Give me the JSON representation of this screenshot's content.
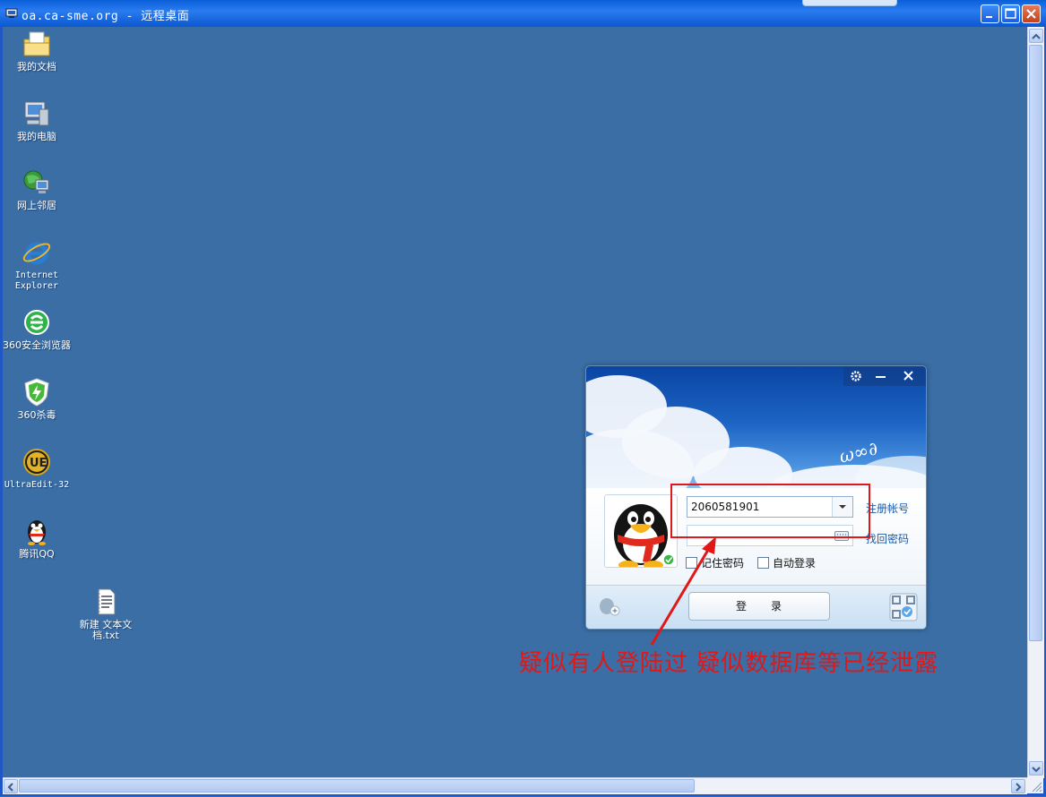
{
  "window": {
    "title_host": "oa.ca-sme.org",
    "title_sep": " - ",
    "title_app": "远程桌面"
  },
  "desktop_icons": [
    {
      "label": "我的文档",
      "icon": "my-documents-icon"
    },
    {
      "label": "我的电脑",
      "icon": "my-computer-icon"
    },
    {
      "label": "网上邻居",
      "icon": "network-places-icon"
    },
    {
      "label": "Internet Explorer",
      "icon": "internet-explorer-icon"
    },
    {
      "label": "360安全浏览器",
      "icon": "360-browser-icon"
    },
    {
      "label": "360杀毒",
      "icon": "360-antivirus-icon"
    },
    {
      "label": "UltraEdit-32",
      "icon": "ultraedit-icon"
    },
    {
      "label": "腾讯QQ",
      "icon": "qq-penguin-icon"
    },
    {
      "label": "新建 文本文档.txt",
      "icon": "text-file-icon"
    }
  ],
  "qq_login": {
    "account": "2060581901",
    "register_link": "注册帐号",
    "recover_link": "找回密码",
    "remember_password": "记住密码",
    "auto_login": "自动登录",
    "login_button": "登　　录",
    "colors": {
      "sky": "#1d64c4",
      "link": "#1a59a8"
    }
  },
  "annotation": {
    "text": "疑似有人登陆过  疑似数据库等已经泄露",
    "color": "#e01818"
  }
}
